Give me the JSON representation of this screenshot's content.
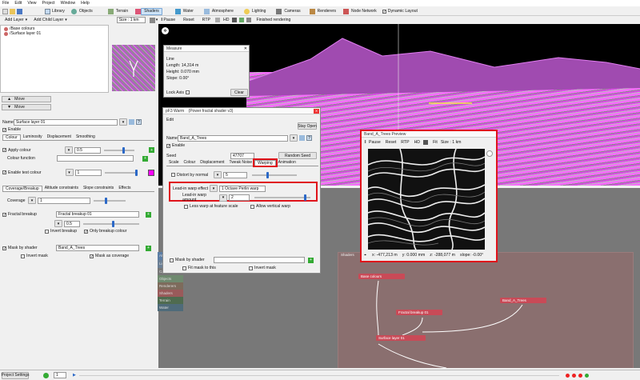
{
  "menu": {
    "items": [
      "File",
      "Edit",
      "View",
      "Project",
      "Window",
      "Help"
    ]
  },
  "toolbar": {
    "row1": [
      "Objects",
      "Terrain",
      "Shaders",
      "Water",
      "Atmosphere",
      "Lighting",
      "Cameras",
      "Renderers",
      "Node Network",
      "Dynamic Layout"
    ],
    "library_label": "Library",
    "add_layer": "Add Layer",
    "add_child_layer": "Add Child Layer",
    "size_value": "Size : 1 km",
    "pause": "Pause",
    "reset": "Reset",
    "rtp": "RTP",
    "hd": "HD",
    "status": "Finished rendering"
  },
  "layers": {
    "items": [
      "/Base colours",
      "/Surface layer 01"
    ]
  },
  "move_up": "Move",
  "move_down": "Move",
  "props": {
    "name_label": "Name",
    "name_value": "Surface layer 01",
    "enable_label": "Enable",
    "tabs": [
      "Colour",
      "Luminosity",
      "Displacement",
      "Smoothing"
    ],
    "apply_colour": "Apply colour",
    "apply_colour_value": "0.5",
    "colour_function": "Colour function",
    "enable_test_colour": "Enable test colour",
    "test_value": "1",
    "tabs2": [
      "Coverage/Breakup",
      "Altitude constraints",
      "Slope constraints",
      "Effects"
    ],
    "coverage": "Coverage",
    "coverage_value": "1",
    "fractal_breakup": "Fractal breakup",
    "fractal_value": "Fractal breakup 01",
    "breakup_value": "0.5",
    "invert_breakup": "Invert breakup",
    "only_breakup_colour": "Only breakup colour",
    "mask_by_shader": "Mask by shader",
    "mask_value": "Band_A_Trees",
    "invert_mask": "Invert mask",
    "mask_as_coverage": "Mask as coverage"
  },
  "measure": {
    "title": "Measure",
    "line": "Line",
    "length": "Length: 14,314 m",
    "height": "Height: 0.070 mm",
    "slope": "Slope: 0.00°",
    "lock_axis": "Lock Axis",
    "clear": "Clear"
  },
  "warp": {
    "title": "pF3 Warm",
    "subtitle": "(Power fractal shader v3)",
    "edit": "Edit",
    "stay_open": "Stay Open",
    "name_label": "Name",
    "name_value": "Band_A_Trees",
    "enable": "Enable",
    "seed_label": "Seed",
    "seed_value": "47707",
    "random_seed": "Random Seed",
    "tabs": [
      "Scale",
      "Colour",
      "Displacement",
      "Tweak Noise",
      "Warping",
      "Animation"
    ],
    "distort_by_normal": "Distort by normal",
    "distort_value": "5",
    "lead_in_effect": "Lead-in warp effect",
    "lead_in_effect_value": "1 Octave Perlin warp",
    "lead_in_amount": "Lead-in warp amount",
    "lead_in_amount_value": "2",
    "less_warp": "Less warp at feature scale",
    "allow_vertical": "Allow vertical warp",
    "mask_by_shader": "Mask by shader",
    "fit_mask": "Fit mask to this",
    "invert_mask": "Invert mask"
  },
  "preview": {
    "title": "Band_A_Trees Preview",
    "pause": "Pause",
    "reset": "Reset",
    "rtp": "RTP",
    "hd": "HD",
    "fit": "Fit",
    "size": "Size : 1 km",
    "coord_x": "x: -477,213 m",
    "coord_y": "y: 0.000 mm",
    "coord_z": "z: -288,077 m",
    "slope": "slope: -0.00°"
  },
  "sidebar": {
    "items": [
      "Atm",
      "Ligh",
      "Cam",
      "Objects",
      "Renderers",
      "Shaders",
      "Terrain",
      "Water"
    ]
  },
  "network": {
    "label": "Shaders",
    "nodes": [
      "Base colours",
      "Band_A_Trees",
      "Fractal breakup 01",
      "Surface layer 01"
    ]
  },
  "status": {
    "project_settings": "Project Settings",
    "frame": "1"
  }
}
